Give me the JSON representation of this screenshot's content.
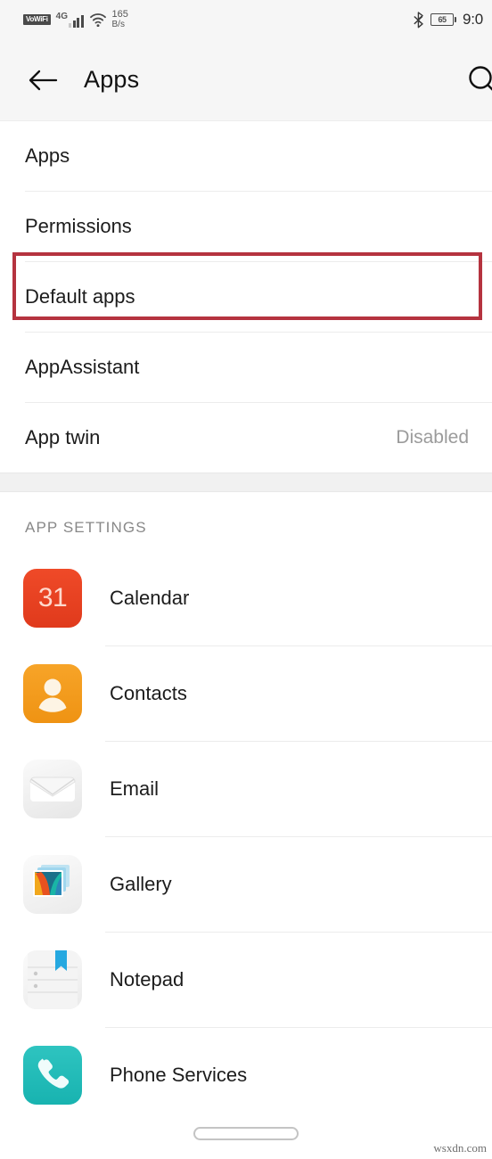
{
  "status_bar": {
    "vowifi_badge": "VoWiFi",
    "network_type": "4G",
    "data_speed_value": "165",
    "data_speed_unit": "B/s",
    "bluetooth_icon": "bluetooth-icon",
    "battery_level": "65",
    "time": "9:0"
  },
  "header": {
    "back_icon": "back-arrow-icon",
    "title": "Apps",
    "search_icon": "search-icon"
  },
  "settings": {
    "rows": [
      {
        "label": "Apps",
        "value": ""
      },
      {
        "label": "Permissions",
        "value": ""
      },
      {
        "label": "Default apps",
        "value": "",
        "highlighted": true
      },
      {
        "label": "AppAssistant",
        "value": ""
      },
      {
        "label": "App twin",
        "value": "Disabled"
      }
    ],
    "highlight_color": "#b5333f"
  },
  "app_settings": {
    "section_title": "APP SETTINGS",
    "apps": [
      {
        "name": "Calendar",
        "icon": "calendar-icon",
        "icon_color": "#ef4a28",
        "icon_text": "31"
      },
      {
        "name": "Contacts",
        "icon": "contacts-icon",
        "icon_color": "#f7a428"
      },
      {
        "name": "Email",
        "icon": "email-icon",
        "icon_color": "#eaeaea"
      },
      {
        "name": "Gallery",
        "icon": "gallery-icon",
        "icon_color": "#eaeaea"
      },
      {
        "name": "Notepad",
        "icon": "notepad-icon",
        "icon_color": "#eaeaea"
      },
      {
        "name": "Phone Services",
        "icon": "phone-services-icon",
        "icon_color": "#1fb9b6"
      }
    ]
  },
  "bottom": {
    "home_indicator": "home-indicator",
    "watermark": "wsxdn.com"
  }
}
